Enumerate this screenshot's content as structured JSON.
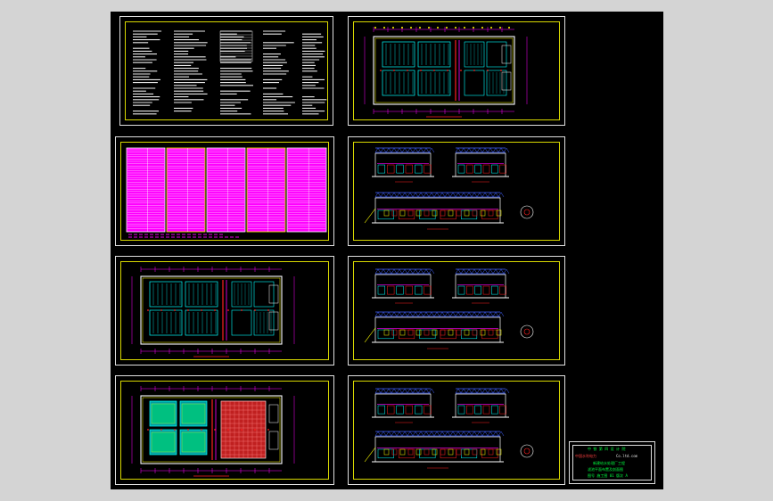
{
  "viewer": {
    "background": "#d4d4d4",
    "drawing_background": "#000000"
  },
  "colors": {
    "frame": "#e0e0e0",
    "border": "#d8d800",
    "cyan": "#00ffff",
    "magenta": "#ff00ff",
    "red": "#ff2020",
    "yellow": "#ffff00",
    "green": "#00ff40",
    "blue": "#4060ff",
    "white": "#ffffff"
  },
  "sheets": [
    {
      "id": "sheet-notes",
      "kind": "text-notes"
    },
    {
      "id": "sheet-plan-top",
      "kind": "floor-plan"
    },
    {
      "id": "sheet-schedule",
      "kind": "material-table"
    },
    {
      "id": "sheet-sections-1",
      "kind": "sections"
    },
    {
      "id": "sheet-plan-mid",
      "kind": "floor-plan"
    },
    {
      "id": "sheet-sections-2",
      "kind": "sections"
    },
    {
      "id": "sheet-plan-bottom",
      "kind": "floor-plan"
    },
    {
      "id": "sheet-sections-3",
      "kind": "sections"
    }
  ],
  "title_block": {
    "line1": "中 铁 第 四 设 计 院",
    "line2": "中国水利电力",
    "line3": "Co.ltd.com",
    "line4": "新建给水处理厂工程",
    "line5": "滤池平面布置及剖面图",
    "line6": "图号 施工图 01 版次 A"
  }
}
